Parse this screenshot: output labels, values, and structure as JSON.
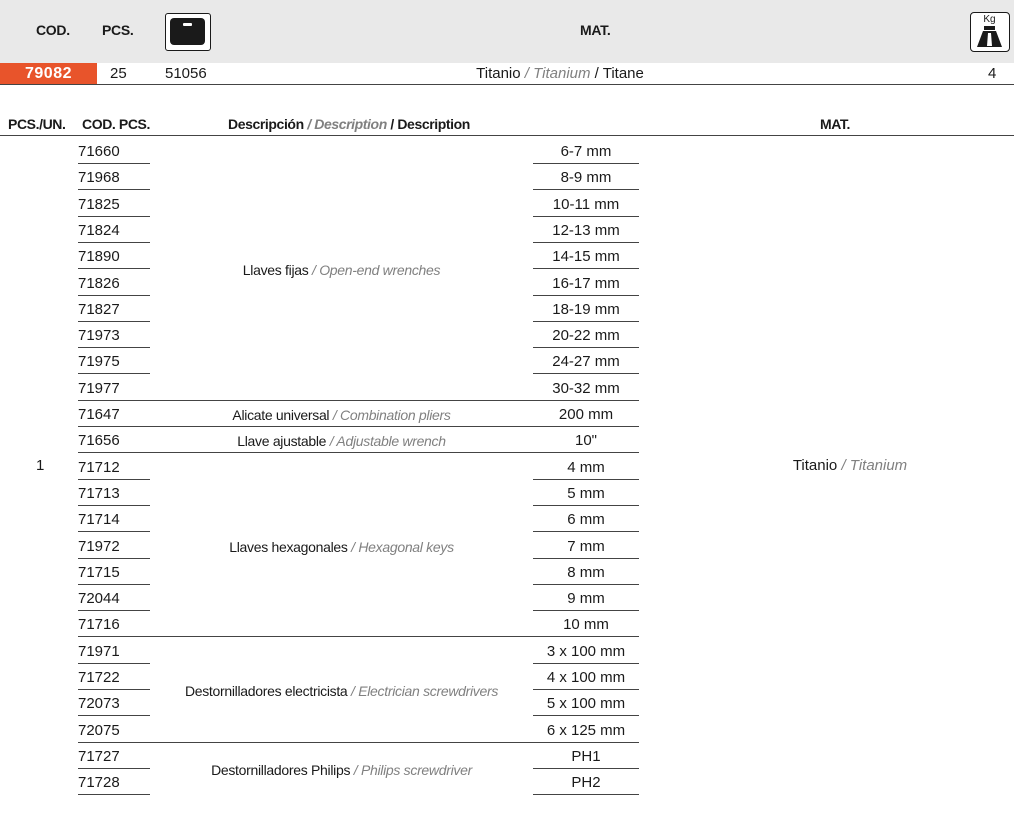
{
  "header": {
    "cod_label": "COD.",
    "pcs_label": "PCS.",
    "case_icon": "toolcase-icon",
    "mat_label": "MAT.",
    "weight_icon": "weight-kg-icon",
    "weight_icon_text": "Kg"
  },
  "kit": {
    "code": "79082",
    "pcs": "25",
    "case": "51056",
    "mat_es": "Titanio",
    "sep1": " / ",
    "mat_en": "Titanium",
    "sep2": " / ",
    "mat_fr": "Titane",
    "weight": "4"
  },
  "table": {
    "headers": {
      "pcs_un": "PCS./UN.",
      "cod_pcs": "COD. PCS.",
      "desc_es": "Descripción",
      "desc_sep1": " / ",
      "desc_en": "Description",
      "desc_sep2": " / ",
      "desc_fr": "Description",
      "mat": "MAT."
    },
    "pcs_un_value": "1",
    "material": {
      "es": "Titanio",
      "sep": " / ",
      "en": "Titanium"
    },
    "rows": [
      {
        "code": "71660",
        "size": "6-7 mm"
      },
      {
        "code": "71968",
        "size": "8-9 mm"
      },
      {
        "code": "71825",
        "size": "10-11 mm"
      },
      {
        "code": "71824",
        "size": "12-13 mm"
      },
      {
        "code": "71890",
        "size": "14-15 mm"
      },
      {
        "code": "71826",
        "size": "16-17 mm"
      },
      {
        "code": "71827",
        "size": "18-19 mm"
      },
      {
        "code": "71973",
        "size": "20-22 mm"
      },
      {
        "code": "71975",
        "size": "24-27 mm"
      },
      {
        "code": "71977",
        "size": "30-32 mm"
      },
      {
        "code": "71647",
        "size": "200 mm"
      },
      {
        "code": "71656",
        "size": "10\""
      },
      {
        "code": "71712",
        "size": "4 mm"
      },
      {
        "code": "71713",
        "size": "5 mm"
      },
      {
        "code": "71714",
        "size": "6 mm"
      },
      {
        "code": "71972",
        "size": "7 mm"
      },
      {
        "code": "71715",
        "size": "8 mm"
      },
      {
        "code": "72044",
        "size": "9 mm"
      },
      {
        "code": "71716",
        "size": "10 mm"
      },
      {
        "code": "71971",
        "size": "3 x 100 mm"
      },
      {
        "code": "71722",
        "size": "4 x 100 mm"
      },
      {
        "code": "72073",
        "size": "5 x 100 mm"
      },
      {
        "code": "72075",
        "size": "6 x 125 mm"
      },
      {
        "code": "71727",
        "size": "PH1"
      },
      {
        "code": "71728",
        "size": "PH2"
      }
    ],
    "groups": [
      {
        "start": 0,
        "count": 10,
        "es": "Llaves fijas",
        "sep": " / ",
        "en": "Open-end wrenches"
      },
      {
        "start": 10,
        "count": 1,
        "es": "Alicate universal",
        "sep": " / ",
        "en": "Combination pliers"
      },
      {
        "start": 11,
        "count": 1,
        "es": "Llave ajustable",
        "sep": " / ",
        "en": "Adjustable wrench"
      },
      {
        "start": 12,
        "count": 7,
        "es": "Llaves hexagonales",
        "sep": " / ",
        "en": "Hexagonal keys"
      },
      {
        "start": 19,
        "count": 4,
        "es": "Destornilladores electricista",
        "sep": " / ",
        "en": "Electrician screwdrivers"
      },
      {
        "start": 23,
        "count": 2,
        "es": "Destornilladores Philips",
        "sep": " / ",
        "en": "Philips screwdriver"
      }
    ]
  }
}
